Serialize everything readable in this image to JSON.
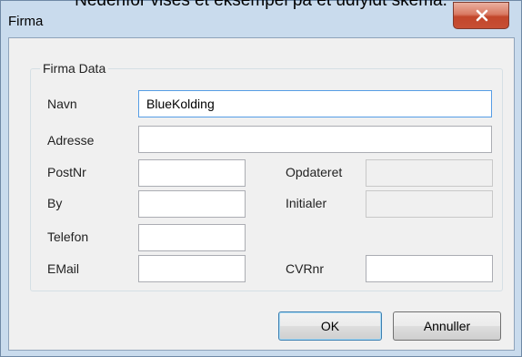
{
  "page_caption": "Nedenfor vises et eksempel på et udfyldt skema.",
  "window": {
    "title": "Firma",
    "close_glyph": "x"
  },
  "group": {
    "legend": "Firma Data"
  },
  "fields": {
    "navn": {
      "label": "Navn",
      "value": "BlueKolding"
    },
    "adresse": {
      "label": "Adresse",
      "value": ""
    },
    "postnr": {
      "label": "PostNr",
      "value": ""
    },
    "by": {
      "label": "By",
      "value": ""
    },
    "telefon": {
      "label": "Telefon",
      "value": ""
    },
    "email": {
      "label": "EMail",
      "value": ""
    },
    "opdateret": {
      "label": "Opdateret",
      "value": ""
    },
    "initialer": {
      "label": "Initialer",
      "value": ""
    },
    "cvrnr": {
      "label": "CVRnr",
      "value": ""
    }
  },
  "buttons": {
    "ok": "OK",
    "cancel": "Annuller"
  },
  "colors": {
    "close_button": "#c74f34",
    "window_frame": "#c9dbed",
    "focus_border": "#569de5"
  }
}
